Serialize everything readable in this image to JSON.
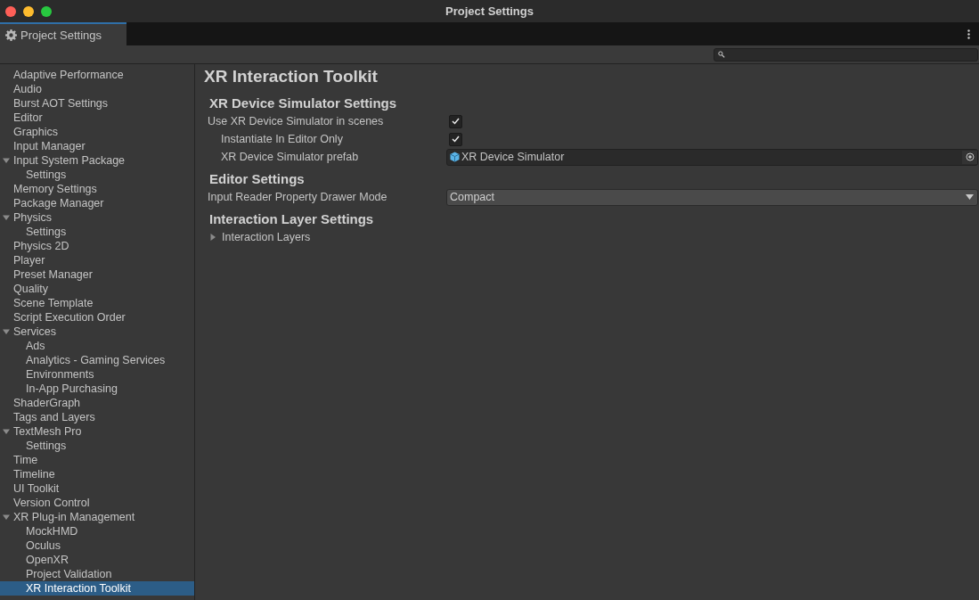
{
  "window": {
    "title": "Project Settings"
  },
  "tab": {
    "label": "Project Settings",
    "selected": true
  },
  "sidebar": {
    "items": [
      {
        "label": "Adaptive Performance",
        "selected": false
      },
      {
        "label": "Audio",
        "selected": false
      },
      {
        "label": "Burst AOT Settings",
        "selected": false
      },
      {
        "label": "Editor",
        "selected": false
      },
      {
        "label": "Graphics",
        "selected": false
      },
      {
        "label": "Input Manager",
        "selected": false
      },
      {
        "label": "Input System Package",
        "selected": false,
        "expanded": true,
        "children": [
          {
            "label": "Settings",
            "selected": false
          }
        ]
      },
      {
        "label": "Memory Settings",
        "selected": false
      },
      {
        "label": "Package Manager",
        "selected": false
      },
      {
        "label": "Physics",
        "selected": false,
        "expanded": true,
        "children": [
          {
            "label": "Settings",
            "selected": false
          }
        ]
      },
      {
        "label": "Physics 2D",
        "selected": false
      },
      {
        "label": "Player",
        "selected": false
      },
      {
        "label": "Preset Manager",
        "selected": false
      },
      {
        "label": "Quality",
        "selected": false
      },
      {
        "label": "Scene Template",
        "selected": false
      },
      {
        "label": "Script Execution Order",
        "selected": false
      },
      {
        "label": "Services",
        "selected": false,
        "expanded": true,
        "children": [
          {
            "label": "Ads",
            "selected": false
          },
          {
            "label": "Analytics - Gaming Services",
            "selected": false
          },
          {
            "label": "Environments",
            "selected": false
          },
          {
            "label": "In-App Purchasing",
            "selected": false
          }
        ]
      },
      {
        "label": "ShaderGraph",
        "selected": false
      },
      {
        "label": "Tags and Layers",
        "selected": false
      },
      {
        "label": "TextMesh Pro",
        "selected": false,
        "expanded": true,
        "children": [
          {
            "label": "Settings",
            "selected": false
          }
        ]
      },
      {
        "label": "Time",
        "selected": false
      },
      {
        "label": "Timeline",
        "selected": false
      },
      {
        "label": "UI Toolkit",
        "selected": false
      },
      {
        "label": "Version Control",
        "selected": false
      },
      {
        "label": "XR Plug-in Management",
        "selected": false,
        "expanded": true,
        "children": [
          {
            "label": "MockHMD",
            "selected": false
          },
          {
            "label": "Oculus",
            "selected": false
          },
          {
            "label": "OpenXR",
            "selected": false
          },
          {
            "label": "Project Validation",
            "selected": false
          },
          {
            "label": "XR Interaction Toolkit",
            "selected": true
          }
        ]
      }
    ]
  },
  "content": {
    "title": "XR Interaction Toolkit",
    "sections": [
      {
        "heading": "XR Device Simulator Settings",
        "properties": [
          {
            "kind": "checkbox",
            "label": "Use XR Device Simulator in scenes",
            "checked": true,
            "children": [
              {
                "kind": "checkbox",
                "label": "Instantiate In Editor Only",
                "checked": true
              },
              {
                "kind": "object",
                "label": "XR Device Simulator prefab",
                "value": "XR Device Simulator"
              }
            ]
          }
        ]
      },
      {
        "heading": "Editor Settings",
        "properties": [
          {
            "kind": "dropdown",
            "label": "Input Reader Property Drawer Mode",
            "value": "Compact"
          }
        ]
      },
      {
        "heading": "Interaction Layer Settings",
        "properties": [
          {
            "kind": "foldout",
            "label": "Interaction Layers",
            "expanded": false
          }
        ]
      }
    ]
  }
}
